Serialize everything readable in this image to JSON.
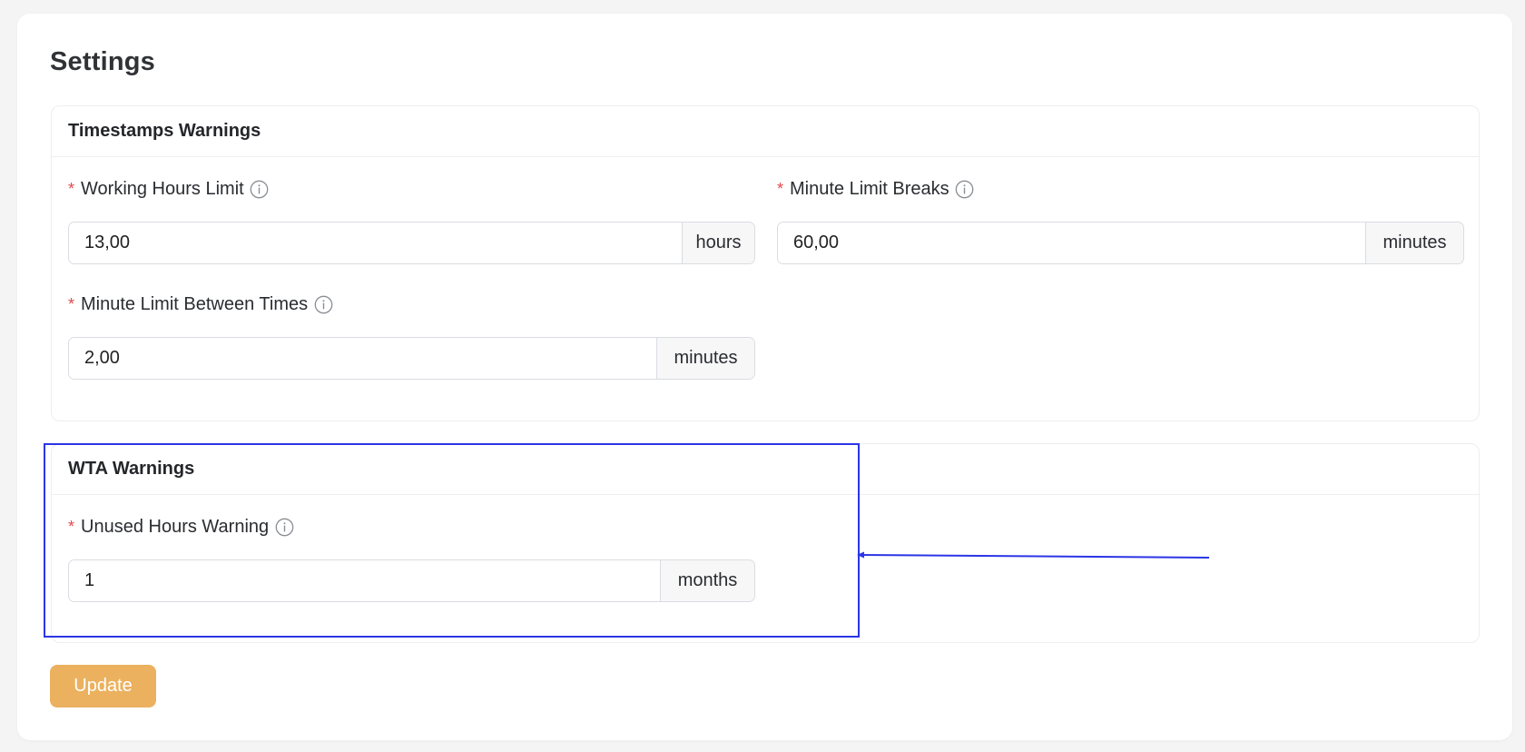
{
  "page": {
    "title": "Settings"
  },
  "timestamps_section": {
    "title": "Timestamps Warnings",
    "fields": [
      {
        "label": "Working Hours Limit",
        "value": "13,00",
        "unit": "hours",
        "required": true
      },
      {
        "label": "Minute Limit Breaks",
        "value": "60,00",
        "unit": "minutes",
        "required": true
      },
      {
        "label": "Minute Limit Between Times",
        "value": "2,00",
        "unit": "minutes",
        "required": true
      }
    ]
  },
  "wta_section": {
    "title": "WTA Warnings",
    "fields": [
      {
        "label": "Unused Hours Warning",
        "value": "1",
        "unit": "months",
        "required": true
      }
    ]
  },
  "actions": {
    "update_label": "Update"
  },
  "icons": {
    "info": "info-circle-icon",
    "arrow": "arrow-left-icon"
  },
  "colors": {
    "accent": "#ebb15e",
    "required": "#e5484d",
    "annotation": "#2b35e6"
  }
}
